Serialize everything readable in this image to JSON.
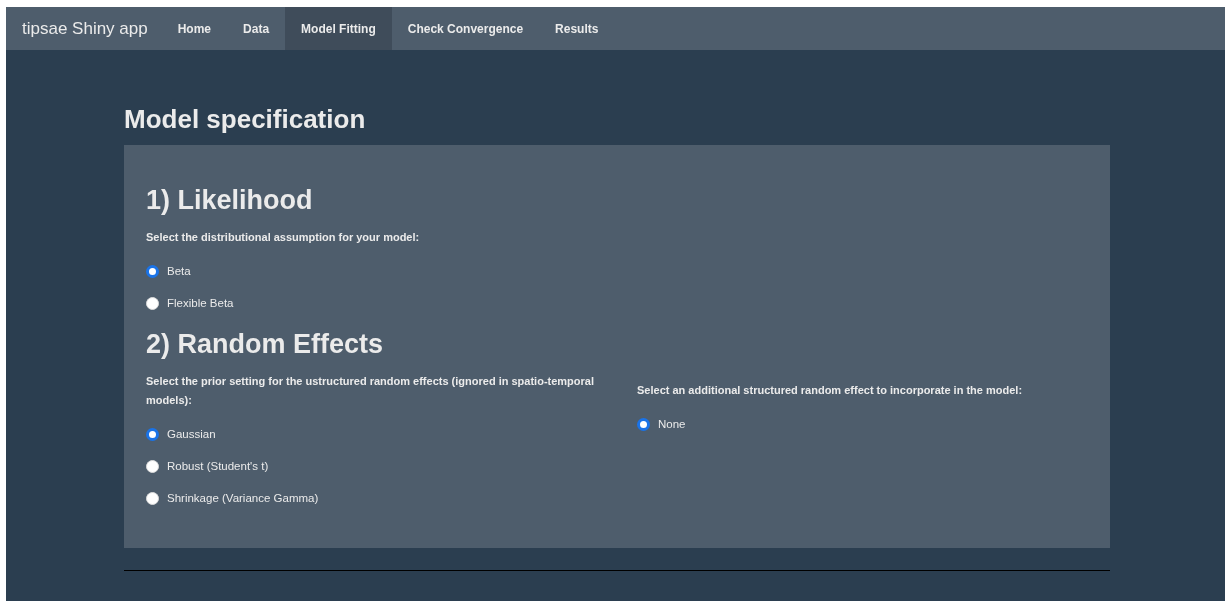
{
  "navbar": {
    "brand": "tipsae Shiny app",
    "tabs": [
      {
        "label": "Home",
        "selected": false
      },
      {
        "label": "Data",
        "selected": false
      },
      {
        "label": "Model Fitting",
        "selected": true
      },
      {
        "label": "Check Convergence",
        "selected": false
      },
      {
        "label": "Results",
        "selected": false
      }
    ]
  },
  "page_title": "Model specification",
  "likelihood": {
    "heading": "1) Likelihood",
    "label": "Select the distributional assumption for your model:",
    "options": [
      {
        "label": "Beta",
        "selected": true
      },
      {
        "label": "Flexible Beta",
        "selected": false
      }
    ]
  },
  "random_effects": {
    "heading": "2) Random Effects",
    "unstructured": {
      "label": "Select the prior setting for the ustructured random effects (ignored in spatio-temporal models):",
      "options": [
        {
          "label": "Gaussian",
          "selected": true
        },
        {
          "label": "Robust (Student's t)",
          "selected": false
        },
        {
          "label": "Shrinkage (Variance Gamma)",
          "selected": false
        }
      ]
    },
    "structured": {
      "label": "Select an additional structured random effect to incorporate in the model:",
      "options": [
        {
          "label": "None",
          "selected": true
        }
      ]
    }
  }
}
